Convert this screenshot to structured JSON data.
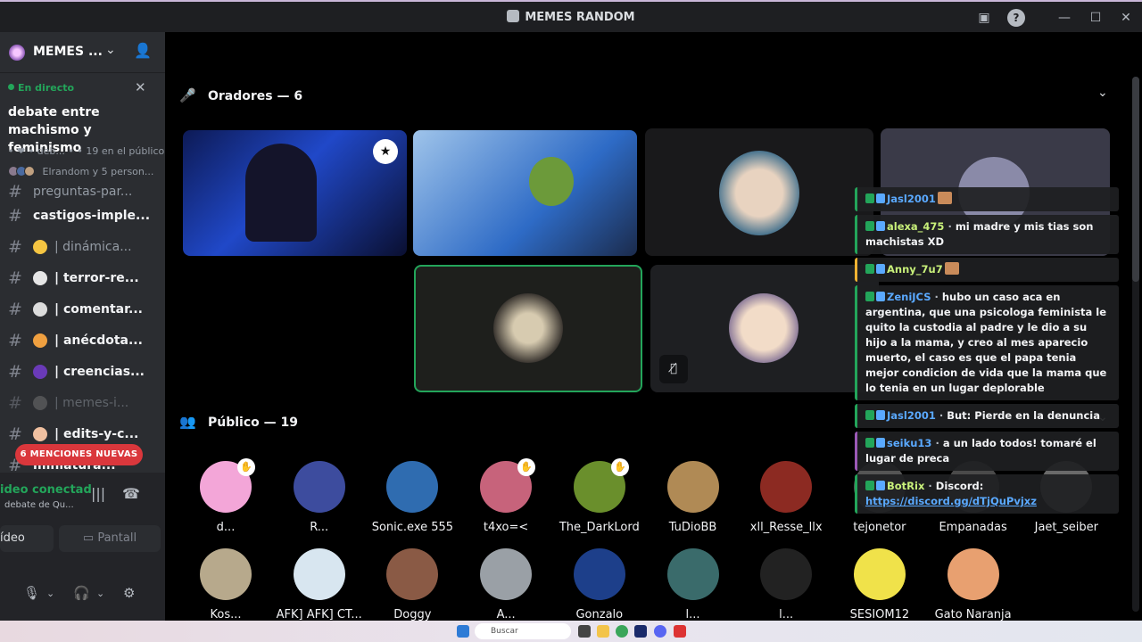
{
  "window": {
    "title": "MEMES RANDOM"
  },
  "server": {
    "name": "MEMES ..."
  },
  "stage": {
    "live_label": "En directo",
    "title": "debate entre machismo y feminismo",
    "meta": "• ❤ • deb... • • 19 en el público",
    "audience_summary": "Elrandom y 5 person..."
  },
  "channels": [
    {
      "label": "preguntas-par...",
      "emoji": "",
      "bold": false,
      "dim": false
    },
    {
      "label": "castigos-imple...",
      "emoji": "",
      "bold": true,
      "dim": false
    },
    {
      "label": "| dinámica...",
      "emoji": "sunglasses",
      "bold": false,
      "dim": false
    },
    {
      "label": "| terror-re...",
      "emoji": "skull",
      "bold": true,
      "dim": false
    },
    {
      "label": "| comentar...",
      "emoji": "speech",
      "bold": true,
      "dim": false
    },
    {
      "label": "| anécdota...",
      "emoji": "flushed",
      "bold": true,
      "dim": false
    },
    {
      "label": "| creencias...",
      "emoji": "purple",
      "bold": true,
      "dim": false
    },
    {
      "label": "| memes-i...",
      "emoji": "camera",
      "bold": false,
      "dim": true
    },
    {
      "label": "| edits-y-c...",
      "emoji": "cake",
      "bold": true,
      "dim": false
    },
    {
      "label": "miniatura...",
      "emoji": "",
      "bold": true,
      "dim": false
    }
  ],
  "mentions_pill": "6 MENCIONES NUEVAS",
  "voice": {
    "status": "ideo conectad",
    "channel": "debate de Qu...",
    "video_label": "ídeo",
    "screen_label": "Pantall"
  },
  "speakers_header": "Oradores — 6",
  "audience_header": "Público — 19",
  "audience": [
    {
      "name": "d...",
      "color": "#f3a6d8",
      "hand": true
    },
    {
      "name": "R...",
      "color": "#3d4c9e",
      "hand": false
    },
    {
      "name": "Sonic.exe 555",
      "color": "#2f6cb0",
      "hand": false
    },
    {
      "name": "t4xo=<",
      "color": "#c7637b",
      "hand": true
    },
    {
      "name": "The_DarkLord",
      "color": "#6a8f2c",
      "hand": true
    },
    {
      "name": "TuDioBB",
      "color": "#b08a55",
      "hand": false
    },
    {
      "name": "xll_Resse_llx",
      "color": "#8c2a22",
      "hand": false
    },
    {
      "name": "tejonetor",
      "color": "#555555",
      "hand": false
    },
    {
      "name": "Empanadas",
      "color": "#4a4a4a",
      "hand": false
    },
    {
      "name": "Jaet_seiber",
      "color": "#6a6a6a",
      "hand": false
    },
    {
      "name": "Kos...",
      "color": "#b7a98c",
      "hand": false
    },
    {
      "name": "AFK] AFK] CT...",
      "color": "#d8e6f0",
      "hand": false
    },
    {
      "name": "Doggy",
      "color": "#8a5a45",
      "hand": false
    },
    {
      "name": "A...",
      "color": "#9aa0a6",
      "hand": false
    },
    {
      "name": "Gonzalo",
      "color": "#1d3f8a",
      "hand": false
    },
    {
      "name": "l...",
      "color": "#3a6b6b",
      "hand": false
    },
    {
      "name": "l...",
      "color": "#222222",
      "hand": false
    },
    {
      "name": "SESIOM12",
      "color": "#f0e24a",
      "hand": false
    },
    {
      "name": "Gato Naranja",
      "color": "#e8a070",
      "hand": false
    }
  ],
  "chat": [
    {
      "user": "Jasl2001",
      "text": "",
      "emote": true,
      "color": "#23a55a"
    },
    {
      "user": "alexa_475",
      "text": "mi madre y mis tias son machistas XD",
      "emote": false,
      "color": "#23a55a",
      "user_green": true
    },
    {
      "user": "Anny_7u7",
      "text": "",
      "emote": true,
      "color": "#f0b232",
      "user_green": true
    },
    {
      "user": "ZeniJCS",
      "text": "hubo un caso aca en argentina, que una psicologa feminista le quito la custodia al padre y le dio a su hijo a la mama, y creo al mes aparecio muerto, el caso es que el papa tenia mejor condicion de vida que la mama que lo tenia en un lugar deplorable",
      "emote": false,
      "color": "#23a55a"
    },
    {
      "user": "Jasl2001",
      "text": "But: Pierde en la denuncia",
      "emote": false,
      "color": "#23a55a"
    },
    {
      "user": "seiku13",
      "text": "a un lado todos! tomaré el lugar de preca",
      "emote": false,
      "color": "#9b59b6"
    },
    {
      "user": "BotRix",
      "text": "Discord: ",
      "link": "https://discord.gg/dTjQuPvjxz",
      "emote": false,
      "color": "#23a55a",
      "user_green": true
    }
  ],
  "taskbar": {
    "search_placeholder": "Buscar"
  }
}
